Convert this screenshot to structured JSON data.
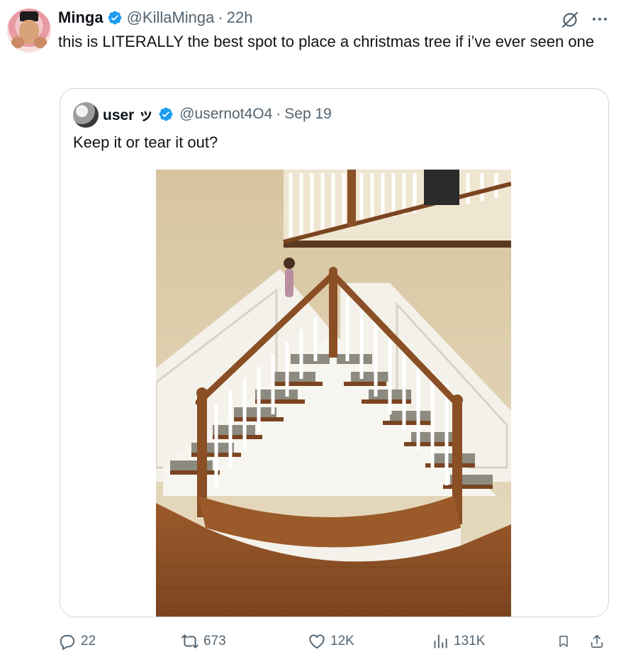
{
  "tweet": {
    "author_name": "Minga",
    "author_handle": "@KillaMinga",
    "separator": "·",
    "time": "22h",
    "text": "this is LITERALLY the best spot to place a christmas tree if i’ve ever seen one",
    "verified_color": "#1d9bf0"
  },
  "quoted": {
    "author_name": "user ッ",
    "author_handle": "@usernot4O4",
    "separator": "·",
    "date": "Sep 19",
    "text": "Keep it or tear it out?",
    "photo_alt": "Photo of a curved double staircase with wooden railings meeting in a corner, forming a nook at the bottom"
  },
  "actions": {
    "replies": "22",
    "reposts": "673",
    "likes": "12K",
    "views": "131K"
  },
  "icons": [
    "grok-icon",
    "more-icon",
    "verified-badge-icon",
    "reply-icon",
    "repost-icon",
    "like-icon",
    "views-icon",
    "bookmark-icon",
    "share-icon"
  ],
  "colors": {
    "text_primary": "#0f1419",
    "text_secondary": "#536471",
    "border": "#cfd9de",
    "accent": "#1d9bf0"
  }
}
